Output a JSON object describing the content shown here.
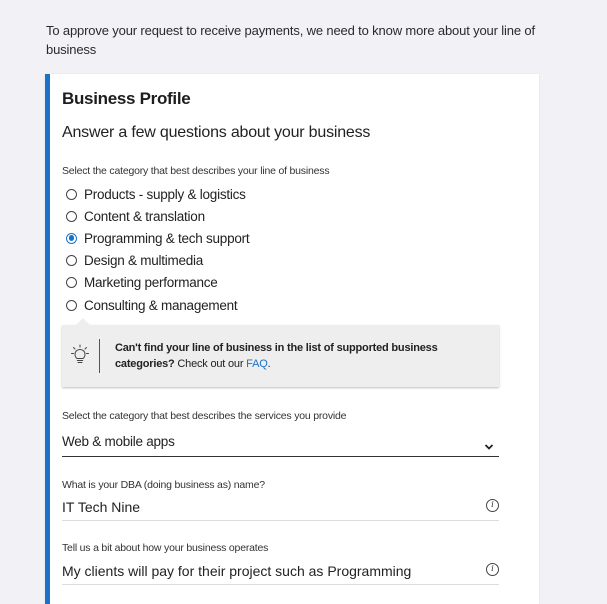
{
  "intro_text": "To approve your request to receive payments, we need to know more about your line of business",
  "card": {
    "title": "Business Profile",
    "subtitle": "Answer a few questions about your business",
    "accent_color": "#1a73c8"
  },
  "business_category": {
    "label": "Select the category that best describes your line of business",
    "selected": "Programming & tech support",
    "options": [
      {
        "label": "Products - supply & logistics",
        "checked": false
      },
      {
        "label": "Content & translation",
        "checked": false
      },
      {
        "label": "Programming & tech support",
        "checked": true
      },
      {
        "label": "Design & multimedia",
        "checked": false
      },
      {
        "label": "Marketing performance",
        "checked": false
      },
      {
        "label": "Consulting & management",
        "checked": false
      }
    ]
  },
  "notice": {
    "icon": "lightbulb-icon",
    "bold_text": "Can't find your line of business in the list of supported business categories?",
    "text": " Check out our ",
    "link_text": "FAQ",
    "end_text": "."
  },
  "services": {
    "label": "Select the category that best describes the services you provide",
    "value": "Web & mobile apps",
    "icon": "chevron-down-icon"
  },
  "dba": {
    "label": "What is your DBA (doing business as) name?",
    "value": "IT Tech Nine",
    "icon": "info-icon"
  },
  "operations": {
    "label": "Tell us a bit about how your business operates",
    "value": "My clients will pay for their project such as Programming",
    "icon": "info-icon"
  }
}
